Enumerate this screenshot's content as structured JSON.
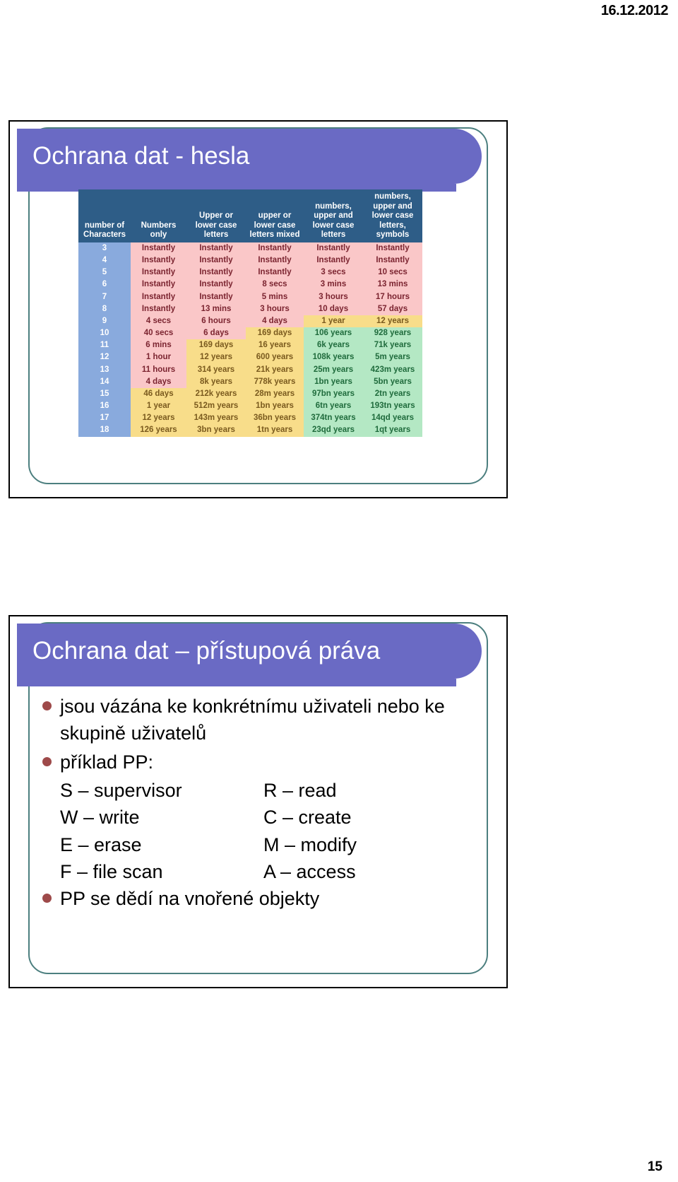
{
  "page": {
    "date": "16.12.2012",
    "number": "15"
  },
  "slide1": {
    "title": "Ochrana dat - hesla",
    "table": {
      "headers": [
        "number of Characters",
        "Numbers only",
        "Upper or lower case letters",
        "upper or lower case letters mixed",
        "numbers, upper and lower case letters",
        "numbers, upper and lower case letters, symbols"
      ],
      "rows": [
        {
          "chars": "3",
          "cells": [
            "Instantly",
            "Instantly",
            "Instantly",
            "Instantly",
            "Instantly"
          ],
          "colors": [
            "red",
            "red",
            "red",
            "red",
            "red"
          ]
        },
        {
          "chars": "4",
          "cells": [
            "Instantly",
            "Instantly",
            "Instantly",
            "Instantly",
            "Instantly"
          ],
          "colors": [
            "red",
            "red",
            "red",
            "red",
            "red"
          ]
        },
        {
          "chars": "5",
          "cells": [
            "Instantly",
            "Instantly",
            "Instantly",
            "3 secs",
            "10 secs"
          ],
          "colors": [
            "red",
            "red",
            "red",
            "red",
            "red"
          ]
        },
        {
          "chars": "6",
          "cells": [
            "Instantly",
            "Instantly",
            "8 secs",
            "3 mins",
            "13 mins"
          ],
          "colors": [
            "red",
            "red",
            "red",
            "red",
            "red"
          ]
        },
        {
          "chars": "7",
          "cells": [
            "Instantly",
            "Instantly",
            "5 mins",
            "3 hours",
            "17 hours"
          ],
          "colors": [
            "red",
            "red",
            "red",
            "red",
            "red"
          ]
        },
        {
          "chars": "8",
          "cells": [
            "Instantly",
            "13 mins",
            "3 hours",
            "10 days",
            "57 days"
          ],
          "colors": [
            "red",
            "red",
            "red",
            "red",
            "red"
          ]
        },
        {
          "chars": "9",
          "cells": [
            "4 secs",
            "6 hours",
            "4 days",
            "1 year",
            "12 years"
          ],
          "colors": [
            "red",
            "red",
            "red",
            "yel",
            "yel"
          ]
        },
        {
          "chars": "10",
          "cells": [
            "40 secs",
            "6 days",
            "169 days",
            "106 years",
            "928 years"
          ],
          "colors": [
            "red",
            "red",
            "yel",
            "grn",
            "grn"
          ]
        },
        {
          "chars": "11",
          "cells": [
            "6 mins",
            "169 days",
            "16 years",
            "6k years",
            "71k years"
          ],
          "colors": [
            "red",
            "yel",
            "yel",
            "grn",
            "grn"
          ]
        },
        {
          "chars": "12",
          "cells": [
            "1 hour",
            "12 years",
            "600 years",
            "108k years",
            "5m years"
          ],
          "colors": [
            "red",
            "yel",
            "yel",
            "grn",
            "grn"
          ]
        },
        {
          "chars": "13",
          "cells": [
            "11 hours",
            "314 years",
            "21k years",
            "25m years",
            "423m years"
          ],
          "colors": [
            "red",
            "yel",
            "yel",
            "grn",
            "grn"
          ]
        },
        {
          "chars": "14",
          "cells": [
            "4 days",
            "8k years",
            "778k years",
            "1bn years",
            "5bn years"
          ],
          "colors": [
            "red",
            "yel",
            "yel",
            "grn",
            "grn"
          ]
        },
        {
          "chars": "15",
          "cells": [
            "46 days",
            "212k years",
            "28m years",
            "97bn years",
            "2tn years"
          ],
          "colors": [
            "yel",
            "yel",
            "yel",
            "grn",
            "grn"
          ]
        },
        {
          "chars": "16",
          "cells": [
            "1 year",
            "512m years",
            "1bn years",
            "6tn years",
            "193tn years"
          ],
          "colors": [
            "yel",
            "yel",
            "yel",
            "grn",
            "grn"
          ]
        },
        {
          "chars": "17",
          "cells": [
            "12 years",
            "143m years",
            "36bn years",
            "374tn years",
            "14qd years"
          ],
          "colors": [
            "yel",
            "yel",
            "yel",
            "grn",
            "grn"
          ]
        },
        {
          "chars": "18",
          "cells": [
            "126 years",
            "3bn years",
            "1tn years",
            "23qd years",
            "1qt years"
          ],
          "colors": [
            "yel",
            "yel",
            "yel",
            "grn",
            "grn"
          ]
        }
      ]
    }
  },
  "slide2": {
    "title": "Ochrana dat – přístupová práva",
    "bullets": [
      "jsou vázána ke konkrétnímu uživateli nebo ke skupině uživatelů",
      "příklad PP:",
      "PP se dědí na vnořené objekty"
    ],
    "permissions": [
      {
        "left": "S – supervisor",
        "right": "R – read"
      },
      {
        "left": "W – write",
        "right": "C – create"
      },
      {
        "left": "E – erase",
        "right": "M – modify"
      },
      {
        "left": "F – file scan",
        "right": "A – access"
      }
    ]
  },
  "colors": {
    "banner": "#6a6ac4",
    "table_header": "#2e5d87",
    "row_head": "#89aadd",
    "red": "#fac7c8",
    "yellow": "#f8dd8a",
    "green": "#b4e8c4",
    "bullet": "#9e4a4a",
    "frame": "#4c7f7f"
  }
}
